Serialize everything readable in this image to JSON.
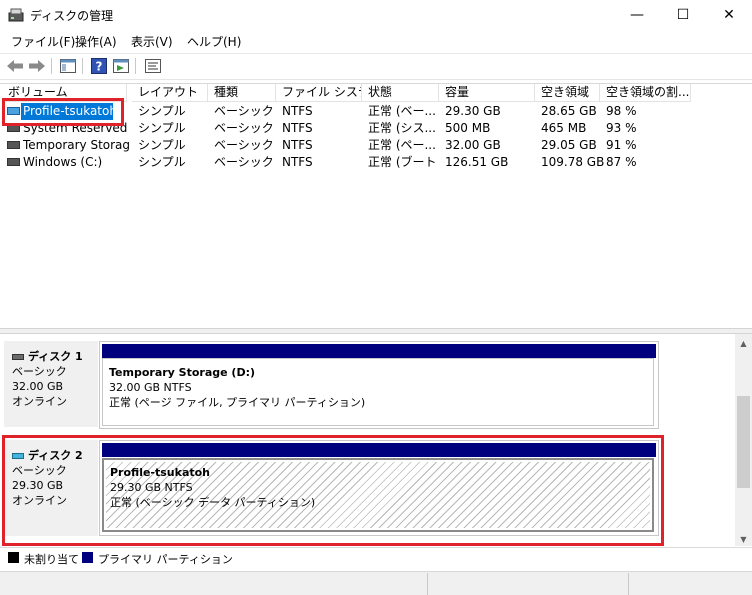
{
  "window": {
    "title": "ディスクの管理",
    "minimize": "—",
    "maximize": "☐",
    "close": "✕"
  },
  "menu": [
    {
      "label": "ファイル(F)"
    },
    {
      "label": "操作(A)"
    },
    {
      "label": "表示(V)"
    },
    {
      "label": "ヘルプ(H)"
    }
  ],
  "toolbar": {
    "icons": [
      "back-arrow-icon",
      "forward-arrow-icon",
      "console-tree-icon",
      "help-icon",
      "show-pane-icon",
      "properties-icon"
    ]
  },
  "volume_table": {
    "columns": [
      "ボリューム",
      "レイアウト",
      "種類",
      "ファイル システム",
      "状態",
      "容量",
      "空き領域",
      "空き領域の割..."
    ],
    "rows": [
      {
        "volume": "Profile-tsukatoh",
        "layout": "シンプル",
        "type": "ベーシック",
        "fs": "NTFS",
        "status": "正常 (ベー...",
        "capacity": "29.30 GB",
        "free": "28.65 GB",
        "pct": "98 %",
        "selected": true
      },
      {
        "volume": "System Reserved",
        "layout": "シンプル",
        "type": "ベーシック",
        "fs": "NTFS",
        "status": "正常 (シス...",
        "capacity": "500 MB",
        "free": "465 MB",
        "pct": "93 %"
      },
      {
        "volume": "Temporary Storag...",
        "layout": "シンプル",
        "type": "ベーシック",
        "fs": "NTFS",
        "status": "正常 (ペー...",
        "capacity": "32.00 GB",
        "free": "29.05 GB",
        "pct": "91 %"
      },
      {
        "volume": "Windows (C:)",
        "layout": "シンプル",
        "type": "ベーシック",
        "fs": "NTFS",
        "status": "正常 (ブート...",
        "capacity": "126.51 GB",
        "free": "109.78 GB",
        "pct": "87 %"
      }
    ]
  },
  "disks": [
    {
      "name": "ディスク 1",
      "type": "ベーシック",
      "size": "32.00 GB",
      "state": "オンライン",
      "partition": {
        "name": "Temporary Storage  (D:)",
        "size_fs": "32.00 GB NTFS",
        "status": "正常 (ページ ファイル, プライマリ パーティション)"
      }
    },
    {
      "name": "ディスク 2",
      "type": "ベーシック",
      "size": "29.30 GB",
      "state": "オンライン",
      "partition": {
        "name": "Profile-tsukatoh",
        "size_fs": "29.30 GB NTFS",
        "status": "正常 (ベーシック データ パーティション)"
      }
    }
  ],
  "legend": [
    {
      "label": "未割り当て",
      "color": "#000000"
    },
    {
      "label": "プライマリ パーティション",
      "color": "#00007f"
    }
  ],
  "colors": {
    "partition_bar": "#00007f",
    "highlight": "#e0232a",
    "selection": "#0078d7"
  }
}
